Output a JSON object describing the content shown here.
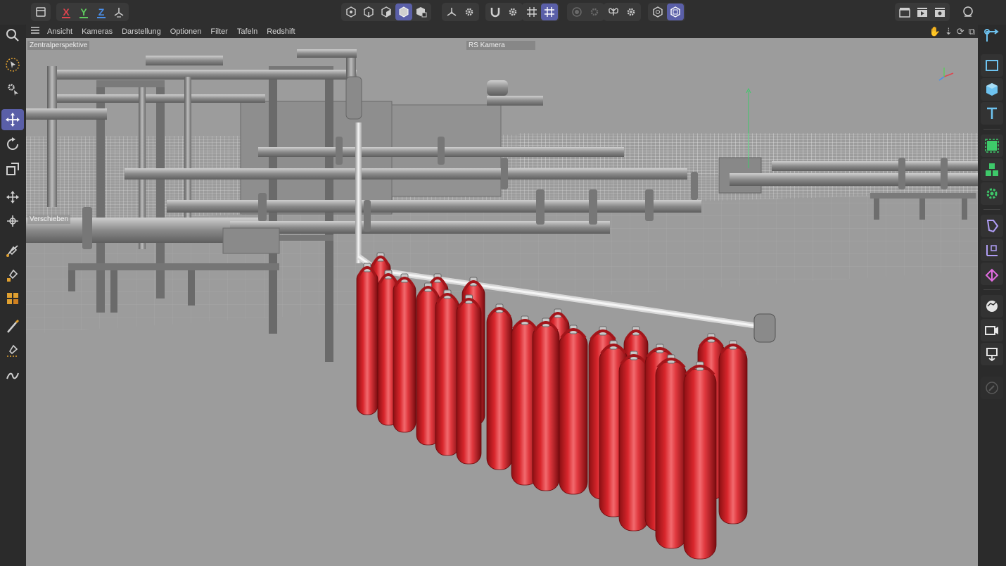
{
  "top_toolbar": {
    "axis_x": "X",
    "axis_y": "Y",
    "axis_z": "Z"
  },
  "viewport": {
    "menu": [
      "Ansicht",
      "Kameras",
      "Darstellung",
      "Optionen",
      "Filter",
      "Tafeln",
      "Redshift"
    ],
    "view_name": "Zentralperspektive",
    "camera": "RS Kamera",
    "tool_label": "Verschieben"
  },
  "colors": {
    "accent": "#5a5fa8",
    "cylinder_red": "#d8262c",
    "viewport_bg": "#9c9c9c",
    "ui_dark": "#2b2b2b"
  }
}
